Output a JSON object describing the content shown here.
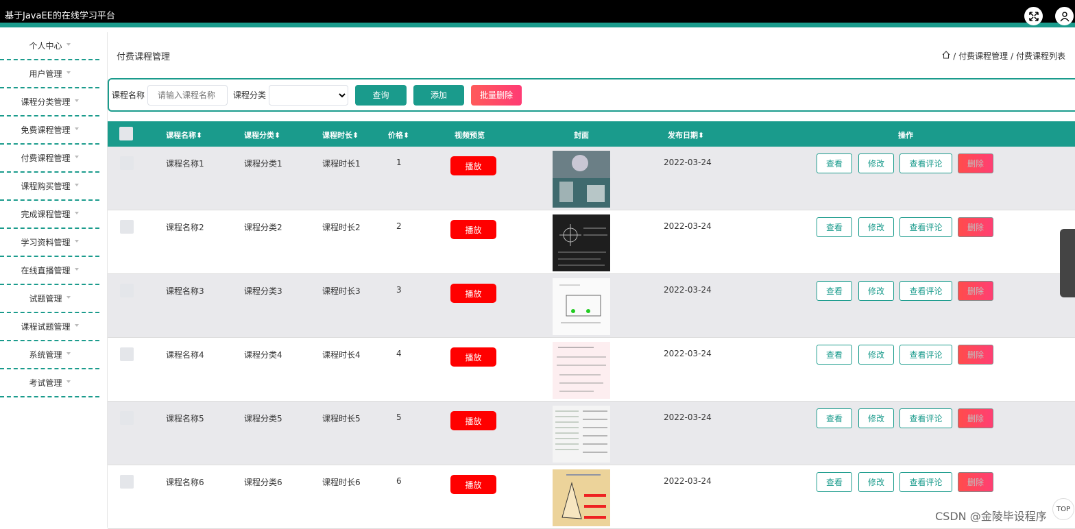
{
  "header": {
    "title": "基于JavaEE的在线学习平台"
  },
  "sidebar": {
    "items": [
      {
        "label": "个人中心"
      },
      {
        "label": "用户管理"
      },
      {
        "label": "课程分类管理"
      },
      {
        "label": "免费课程管理"
      },
      {
        "label": "付费课程管理"
      },
      {
        "label": "课程购买管理"
      },
      {
        "label": "完成课程管理"
      },
      {
        "label": "学习资料管理"
      },
      {
        "label": "在线直播管理"
      },
      {
        "label": "试题管理"
      },
      {
        "label": "课程试题管理"
      },
      {
        "label": "系统管理"
      },
      {
        "label": "考试管理"
      }
    ]
  },
  "page": {
    "title": "付费课程管理",
    "breadcrumb": [
      "/ 付费课程管理",
      "/ 付费课程列表"
    ]
  },
  "search": {
    "name_label": "课程名称",
    "name_placeholder": "请输入课程名称",
    "category_label": "课程分类",
    "query_label": "查询",
    "add_label": "添加",
    "batch_delete_label": "批量删除"
  },
  "table": {
    "columns": {
      "name": "课程名称",
      "category": "课程分类",
      "duration": "课程时长",
      "price": "价格",
      "video": "视频预览",
      "cover": "封面",
      "date": "发布日期",
      "ops": "操作"
    },
    "rows": [
      {
        "name": "课程名称1",
        "category": "课程分类1",
        "duration": "课程时长1",
        "price": "1",
        "date": "2022-03-24"
      },
      {
        "name": "课程名称2",
        "category": "课程分类2",
        "duration": "课程时长2",
        "price": "2",
        "date": "2022-03-24"
      },
      {
        "name": "课程名称3",
        "category": "课程分类3",
        "duration": "课程时长3",
        "price": "3",
        "date": "2022-03-24"
      },
      {
        "name": "课程名称4",
        "category": "课程分类4",
        "duration": "课程时长4",
        "price": "4",
        "date": "2022-03-24"
      },
      {
        "name": "课程名称5",
        "category": "课程分类5",
        "duration": "课程时长5",
        "price": "5",
        "date": "2022-03-24"
      },
      {
        "name": "课程名称6",
        "category": "课程分类6",
        "duration": "课程时长6",
        "price": "6",
        "date": "2022-03-24"
      }
    ],
    "play_label": "播放",
    "view_label": "查看",
    "edit_label": "修改",
    "comments_label": "查看评论",
    "delete_label": "删除"
  },
  "watermark": "CSDN @金陵毕设程序",
  "top_button": "TOP",
  "colors": {
    "accent": "#1a9b8c",
    "danger": "#ff0000"
  }
}
